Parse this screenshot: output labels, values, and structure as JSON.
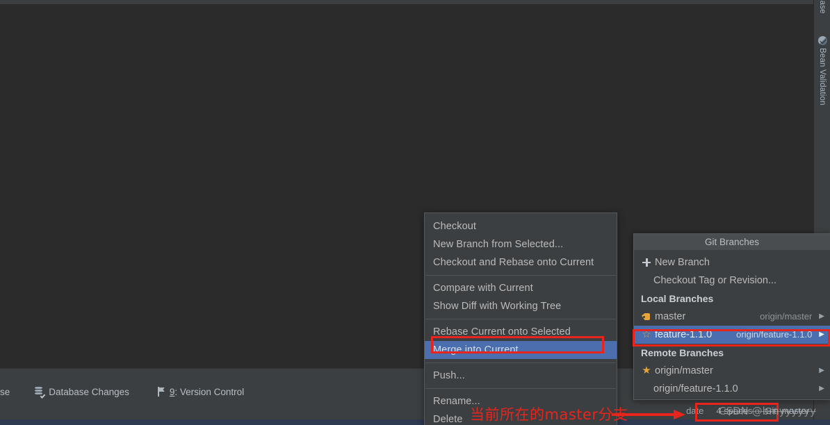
{
  "app": {
    "background_color": "#2b2b2b",
    "panel_color": "#3c3f41",
    "accent_selection": "#4b6eaf",
    "annotation_color": "#e8241c",
    "branch_icon_color": "#e8a33d"
  },
  "right_toolstrip": {
    "items": [
      {
        "label": "base",
        "icon": "database-icon"
      },
      {
        "label": "Bean Validation",
        "icon": "bean-validation-icon"
      }
    ]
  },
  "bottom_toolwindow_bar": {
    "items": [
      {
        "label": "se",
        "icon": "truncated-tool-icon"
      },
      {
        "label": "Database Changes",
        "icon": "database-changes-icon"
      },
      {
        "label_num": "9",
        "label_rest": ": Version Control",
        "icon": "version-control-branch-icon"
      }
    ]
  },
  "status_bar": {
    "segments": [
      {
        "text": "date"
      },
      {
        "text": "4 spaces"
      },
      {
        "text": "Git: master"
      }
    ],
    "git_branch_widget": "Git: master"
  },
  "context_menu": {
    "items": [
      {
        "label": "Checkout",
        "selected": false,
        "separator_after": false
      },
      {
        "label": "New Branch from Selected...",
        "selected": false,
        "separator_after": false
      },
      {
        "label": "Checkout and Rebase onto Current",
        "selected": false,
        "separator_after": true
      },
      {
        "label": "Compare with Current",
        "selected": false,
        "separator_after": false
      },
      {
        "label": "Show Diff with Working Tree",
        "selected": false,
        "separator_after": true
      },
      {
        "label": "Rebase Current onto Selected",
        "selected": false,
        "separator_after": false
      },
      {
        "label": "Merge into Current",
        "selected": true,
        "separator_after": true
      },
      {
        "label": "Push...",
        "selected": false,
        "separator_after": true
      },
      {
        "label": "Rename...",
        "selected": false,
        "separator_after": false
      },
      {
        "label": "Delete",
        "selected": false,
        "separator_after": false
      }
    ]
  },
  "git_branches_popup": {
    "title": "Git Branches",
    "actions": [
      {
        "label": "New Branch",
        "icon": "plus-icon"
      },
      {
        "label": "Checkout Tag or Revision...",
        "icon": "none"
      }
    ],
    "local_header": "Local Branches",
    "local_branches": [
      {
        "name": "master",
        "tracking": "origin/master",
        "icon": "tag-icon",
        "selected": false,
        "has_arrow": true
      },
      {
        "name": "feature-1.1.0",
        "tracking": "origin/feature-1.1.0",
        "icon": "star-outline-icon",
        "selected": true,
        "has_arrow": true
      }
    ],
    "remote_header": "Remote Branches",
    "remote_branches": [
      {
        "name": "origin/master",
        "icon": "star-filled-icon",
        "selected": false,
        "has_arrow": true
      },
      {
        "name": "origin/feature-1.1.0",
        "icon": "none",
        "selected": false,
        "has_arrow": true
      }
    ]
  },
  "annotations": {
    "chinese_note": "当前所在的master分支",
    "highlight_boxes": [
      "merge-into-current",
      "feature-1.1.0-branch-row",
      "git-status-widget"
    ]
  },
  "watermark": {
    "prefix": "CSDN",
    "handle": "@bmyyyyyy"
  }
}
